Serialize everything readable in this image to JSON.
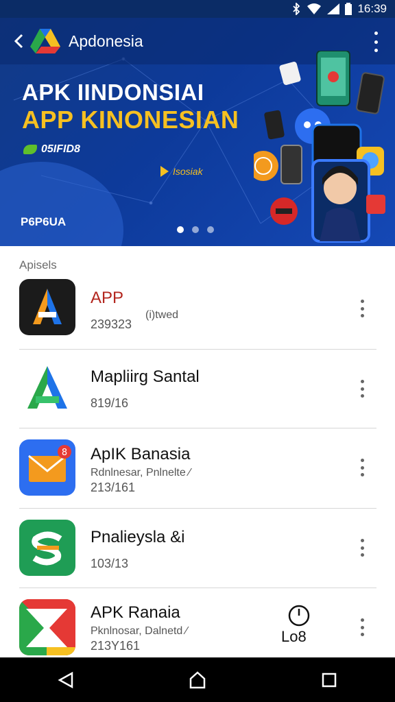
{
  "status_bar": {
    "time": "16:39",
    "icons": [
      "bluetooth-icon",
      "wifi-icon",
      "signal-icon",
      "battery-icon"
    ]
  },
  "app_bar": {
    "title": "Apdonesia",
    "back_icon": "chevron-left-icon",
    "menu_icon": "more-vert-icon"
  },
  "banner": {
    "headline1": "APK IINDONSIAI",
    "headline2": "APP KINONESIAN",
    "pill_text": "05IFID8",
    "play_text": "Isosiak",
    "label": "P6P6UA",
    "carousel": {
      "count": 3,
      "active": 0
    },
    "colors": {
      "background": "#0d3a9a",
      "accent": "#f6c021"
    }
  },
  "section": {
    "label": "Apisels"
  },
  "apps": [
    {
      "name": "APP",
      "tag": "(i)twed",
      "sub": "",
      "meta": "239323",
      "icon": "letter-a-dark-icon",
      "name_color": "#b3261e"
    },
    {
      "name": "Mapliirg Santal",
      "tag": "",
      "sub": "",
      "meta": "819/16",
      "icon": "letter-a-gradient-icon",
      "name_color": "#111111"
    },
    {
      "name": "ApIK Banasia",
      "tag": "",
      "sub": "Rdnlnesar, Pnlnelte ∕",
      "meta": "213/161",
      "icon": "mail-envelope-icon",
      "name_color": "#111111"
    },
    {
      "name": "Pnalieysla &i",
      "tag": "",
      "sub": "",
      "meta": "103/13",
      "icon": "letter-s-green-icon",
      "name_color": "#111111"
    },
    {
      "name": "APK Ranaia",
      "tag": "",
      "sub": "Pknlnosar, Dalnetd ∕",
      "meta": "213Y161",
      "icon": "arrow-x-red-icon",
      "name_color": "#111111",
      "badge_label": "Lo8"
    }
  ],
  "nav": {
    "back_icon": "triangle-back-icon",
    "home_icon": "home-icon",
    "recents_icon": "square-recents-icon"
  }
}
